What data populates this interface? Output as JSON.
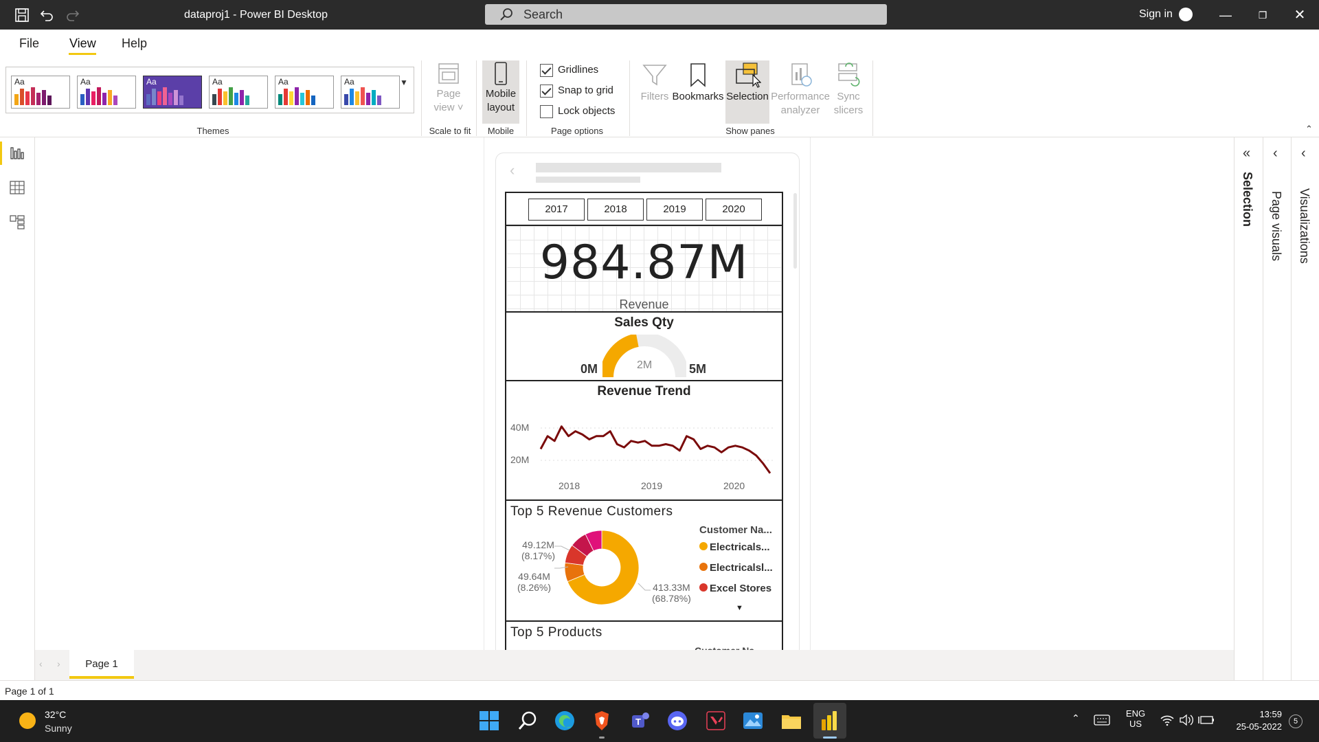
{
  "titlebar": {
    "title": "dataproj1 - Power BI Desktop",
    "search_placeholder": "Search",
    "signin": "Sign in"
  },
  "menu": {
    "file": "File",
    "view": "View",
    "help": "Help"
  },
  "ribbon": {
    "groups": {
      "themes": "Themes",
      "scale": "Scale to fit",
      "mobile": "Mobile",
      "page_options": "Page options",
      "show_panes": "Show panes"
    },
    "page_view": {
      "line1": "Page",
      "line2": "view"
    },
    "mobile_layout": {
      "line1": "Mobile",
      "line2": "layout"
    },
    "gridlines": "Gridlines",
    "snap": "Snap to grid",
    "lock": "Lock objects",
    "filters": "Filters",
    "bookmarks": "Bookmarks",
    "selection": "Selection",
    "perf": {
      "line1": "Performance",
      "line2": "analyzer"
    },
    "sync": {
      "line1": "Sync",
      "line2": "slicers"
    },
    "theme_aa": "Aa"
  },
  "themes": [
    {
      "colors": [
        "#f2a516",
        "#d94f2a",
        "#e8374a",
        "#c42e58",
        "#a3226e",
        "#7e1b6e",
        "#5c1458"
      ],
      "bg": "#ffffff",
      "selected": false
    },
    {
      "colors": [
        "#2b5ec2",
        "#5e35b1",
        "#e91e63",
        "#c2185b",
        "#8e24aa",
        "#f9a825",
        "#ab47bc"
      ],
      "bg": "#ffffff",
      "selected": false
    },
    {
      "colors": [
        "#5c6bc0",
        "#7986cb",
        "#ec407a",
        "#f06292",
        "#ab47bc",
        "#ce93d8",
        "#9575cd"
      ],
      "bg": "#5b3fa8",
      "selected": true
    },
    {
      "colors": [
        "#37474f",
        "#e53935",
        "#fbc02d",
        "#43a047",
        "#1e88e5",
        "#8e24aa",
        "#26a69a"
      ],
      "bg": "#ffffff",
      "selected": false
    },
    {
      "colors": [
        "#00897b",
        "#e53935",
        "#fdd835",
        "#8e24aa",
        "#26c6da",
        "#ef6c00",
        "#1565c0"
      ],
      "bg": "#ffffff",
      "selected": false
    },
    {
      "colors": [
        "#3949ab",
        "#1e88e5",
        "#fbc02d",
        "#ef5350",
        "#8e24aa",
        "#00acc1",
        "#7e57c2"
      ],
      "bg": "#ffffff",
      "selected": false
    }
  ],
  "checkboxes": {
    "gridlines": true,
    "snap": true,
    "lock": false
  },
  "slicer": {
    "years": [
      "2017",
      "2018",
      "2019",
      "2020"
    ]
  },
  "kpi": {
    "value": "984.87M",
    "label": "Revenue"
  },
  "gauge": {
    "title": "Sales Qty",
    "min_label": "0M",
    "max_label": "5M",
    "target_label": "2M",
    "min": 0,
    "max": 5,
    "value": 2.2
  },
  "revenue_trend": {
    "title": "Revenue Trend",
    "y_ticks": [
      "40M",
      "20M"
    ],
    "x_ticks": [
      "2018",
      "2019",
      "2020"
    ]
  },
  "top_customers": {
    "title": "Top 5 Revenue Customers",
    "legend_title": "Customer Na...",
    "legend": [
      {
        "label": "Electricals...",
        "color": "#f5a800"
      },
      {
        "label": "Electricalsl...",
        "color": "#e8730c"
      },
      {
        "label": "Excel Stores",
        "color": "#d9362b"
      }
    ],
    "label_a": {
      "value": "49.12M",
      "pct": "(8.17%)"
    },
    "label_b": {
      "value": "49.64M",
      "pct": "(8.26%)"
    },
    "label_c": {
      "value": "413.33M",
      "pct": "(68.78%)"
    }
  },
  "top_products": {
    "title": "Top 5 Products",
    "cut_label": "Customer Na..."
  },
  "panes": {
    "selection": "Selection",
    "page_visuals": "Page visuals",
    "visualizations": "Visualizations"
  },
  "pages": {
    "tab1": "Page 1",
    "status": "Page 1 of 1"
  },
  "taskbar": {
    "temp": "32°C",
    "weather": "Sunny",
    "lang1": "ENG",
    "lang2": "US",
    "time": "13:59",
    "date": "25-05-2022",
    "notif": "5"
  },
  "colors": {
    "accent": "#f2c811",
    "trend_line": "#7a0a0a",
    "gauge_fill": "#f5a800"
  },
  "chart_data": [
    {
      "type": "line",
      "title": "Revenue Trend",
      "x": [
        "2017-09",
        "2017-10",
        "2017-11",
        "2017-12",
        "2018-01",
        "2018-02",
        "2018-03",
        "2018-04",
        "2018-05",
        "2018-06",
        "2018-07",
        "2018-08",
        "2018-09",
        "2018-10",
        "2018-11",
        "2018-12",
        "2019-01",
        "2019-02",
        "2019-03",
        "2019-04",
        "2019-05",
        "2019-06",
        "2019-07",
        "2019-08",
        "2019-09",
        "2019-10",
        "2019-11",
        "2019-12",
        "2020-01",
        "2020-02",
        "2020-03",
        "2020-04",
        "2020-05",
        "2020-06"
      ],
      "series": [
        {
          "values": [
            27,
            35,
            32,
            41,
            35,
            38,
            36,
            33,
            35,
            35,
            38,
            30,
            28,
            32,
            31,
            32,
            29,
            29,
            30,
            29,
            26,
            35,
            33,
            27,
            29,
            28,
            25,
            28,
            29,
            28,
            26,
            23,
            18,
            12
          ]
        }
      ],
      "ylabel": "",
      "xlabel": "",
      "ylim": [
        10,
        45
      ],
      "y_ticks": [
        "40M",
        "20M"
      ],
      "x_ticks": [
        "2018",
        "2019",
        "2020"
      ]
    },
    {
      "type": "pie",
      "title": "Top 5 Revenue Customers",
      "categories": [
        "Electricals...",
        "Electricalsl...",
        "Excel Stores"
      ],
      "values": [
        68.78,
        8.26,
        8.17,
        7.5,
        7.29
      ],
      "labels": [
        "413.33M (68.78%)",
        "49.64M (8.26%)",
        "49.12M (8.17%)"
      ]
    }
  ]
}
